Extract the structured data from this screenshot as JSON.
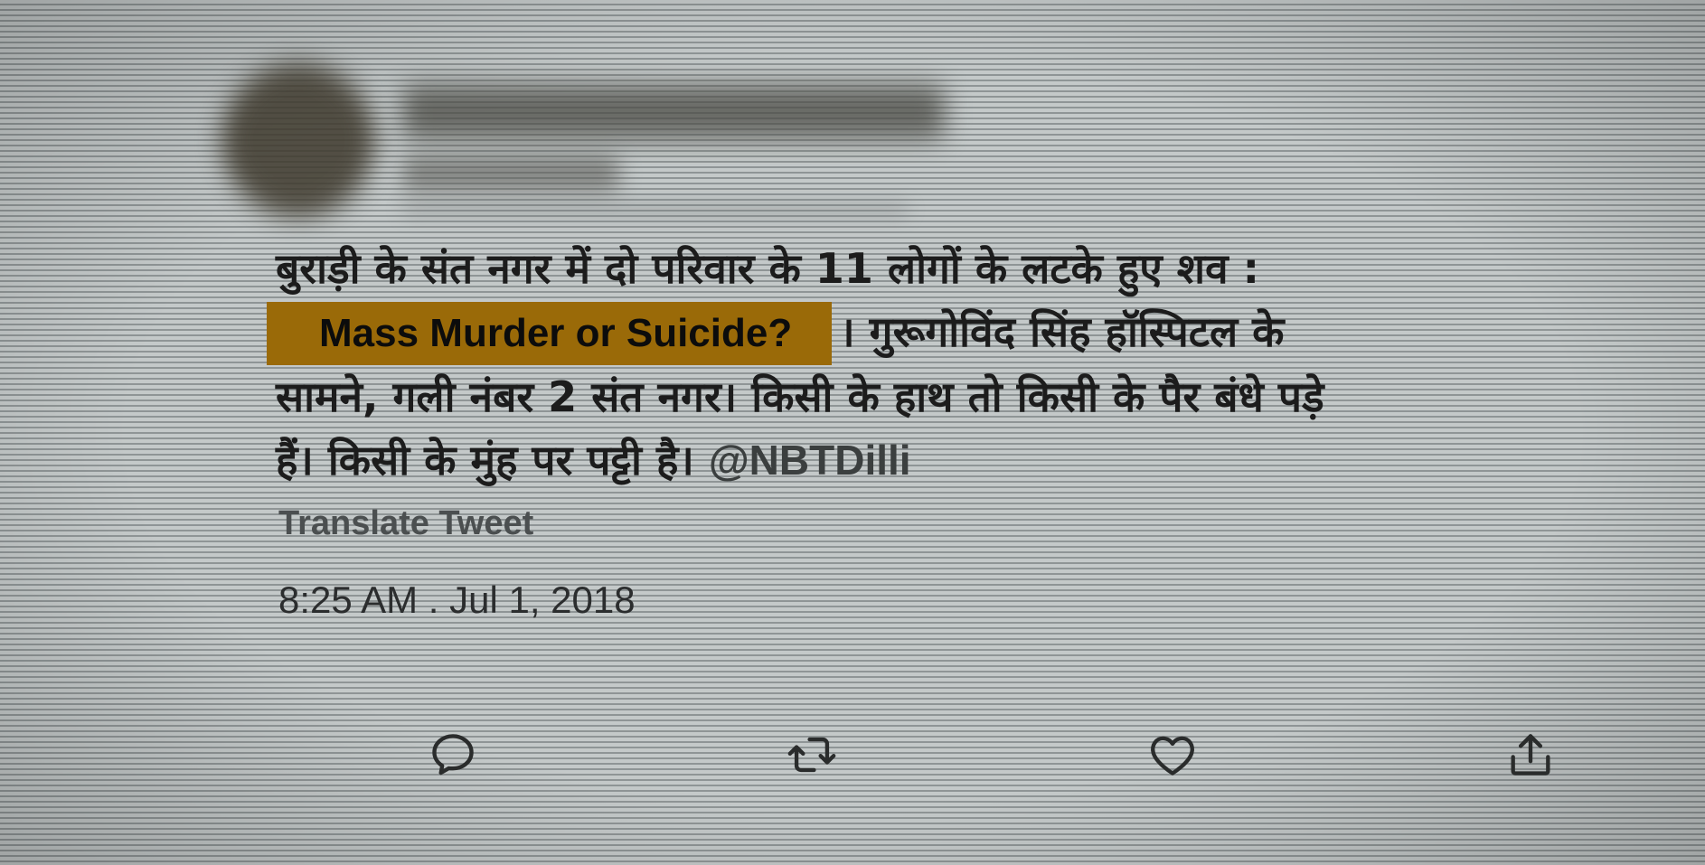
{
  "tweet": {
    "body_lines": [
      "बुराड़ी के संत नगर में दो परिवार के 11 लोगों के लटके हुए शव :",
      "सामने, गली नंबर 2 संत नगर। किसी के हाथ तो किसी के पैर बंधे पड़े"
    ],
    "highlight_text": "Mass Murder or Suicide?",
    "line2_suffix": "। गुरूगोविंद सिंह हॉस्पिटल के",
    "line4_prefix": "हैं। किसी के मुंह पर पट्टी है।",
    "mention": "@NBTDilli",
    "translate_label": "Translate Tweet",
    "timestamp": "8:25 AM . Jul 1, 2018"
  },
  "actions": {
    "reply_icon": "reply-icon",
    "retweet_icon": "retweet-icon",
    "like_icon": "heart-icon",
    "share_icon": "share-icon"
  },
  "colors": {
    "highlight": "#9a6a08",
    "text": "#1c1c1c",
    "icon": "#2a2c2c"
  }
}
